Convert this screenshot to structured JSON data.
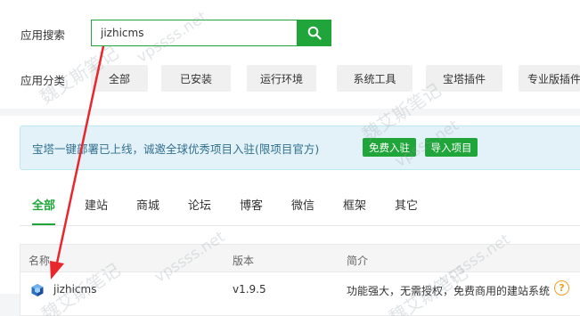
{
  "search": {
    "label": "应用搜索",
    "value": "jizhicms",
    "button_icon": "search-icon"
  },
  "categories": {
    "label": "应用分类",
    "items": [
      "全部",
      "已安装",
      "运行环境",
      "系统工具",
      "宝塔插件",
      "专业版插件"
    ]
  },
  "notice": {
    "text": "宝塔一键部署已上线，诚邀全球优秀项目入驻(限项目官方)",
    "join_button": "免费入驻",
    "import_button": "导入项目"
  },
  "tabs": [
    "全部",
    "建站",
    "商城",
    "论坛",
    "博客",
    "微信",
    "框架",
    "其它"
  ],
  "active_tab": "全部",
  "table": {
    "headers": [
      "名称",
      "版本",
      "简介"
    ],
    "rows": [
      {
        "name": "jizhicms",
        "version": "v1.9.5",
        "description": "功能强大，无需授权，免费商用的建站系统",
        "icon": "cube-app-icon"
      }
    ],
    "help_icon_text": "?"
  },
  "watermarks": {
    "name_text": "魏艾斯笔记",
    "domain_text": "vpssss.net",
    "site_text": "vpsss.net"
  },
  "colors": {
    "accent": "#20a53a",
    "notice_bg": "#e3f1f8",
    "notice_text": "#31708f",
    "arrow": "#e8262b"
  }
}
